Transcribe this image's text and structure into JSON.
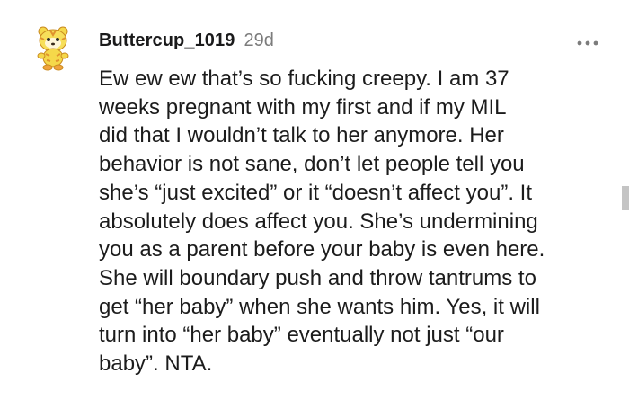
{
  "comment": {
    "username": "Buttercup_1019",
    "timestamp": "29d",
    "avatar_icon": "tiger-snoo-avatar-icon",
    "more_icon": "more-options-icon",
    "body_lines": [
      "Ew ew ew that’s so fucking creepy. I am 37",
      "weeks pregnant with my first and if my MIL",
      "did that I wouldn’t talk to her anymore. Her",
      "behavior is not sane, don’t let people tell you",
      "she’s “just excited” or it “doesn’t affect you”. It",
      "absolutely does affect you. She’s undermining",
      "you as a parent before your baby is even here.",
      "She will boundary push and throw tantrums to",
      "get “her baby” when she wants him. Yes, it will",
      "turn into “her baby” eventually not just “our",
      "baby”. NTA."
    ]
  },
  "colors": {
    "text": "#1c1c1c",
    "meta": "#7c7c7c",
    "avatar_yellow": "#f5d84a",
    "avatar_orange": "#f0a23c"
  }
}
